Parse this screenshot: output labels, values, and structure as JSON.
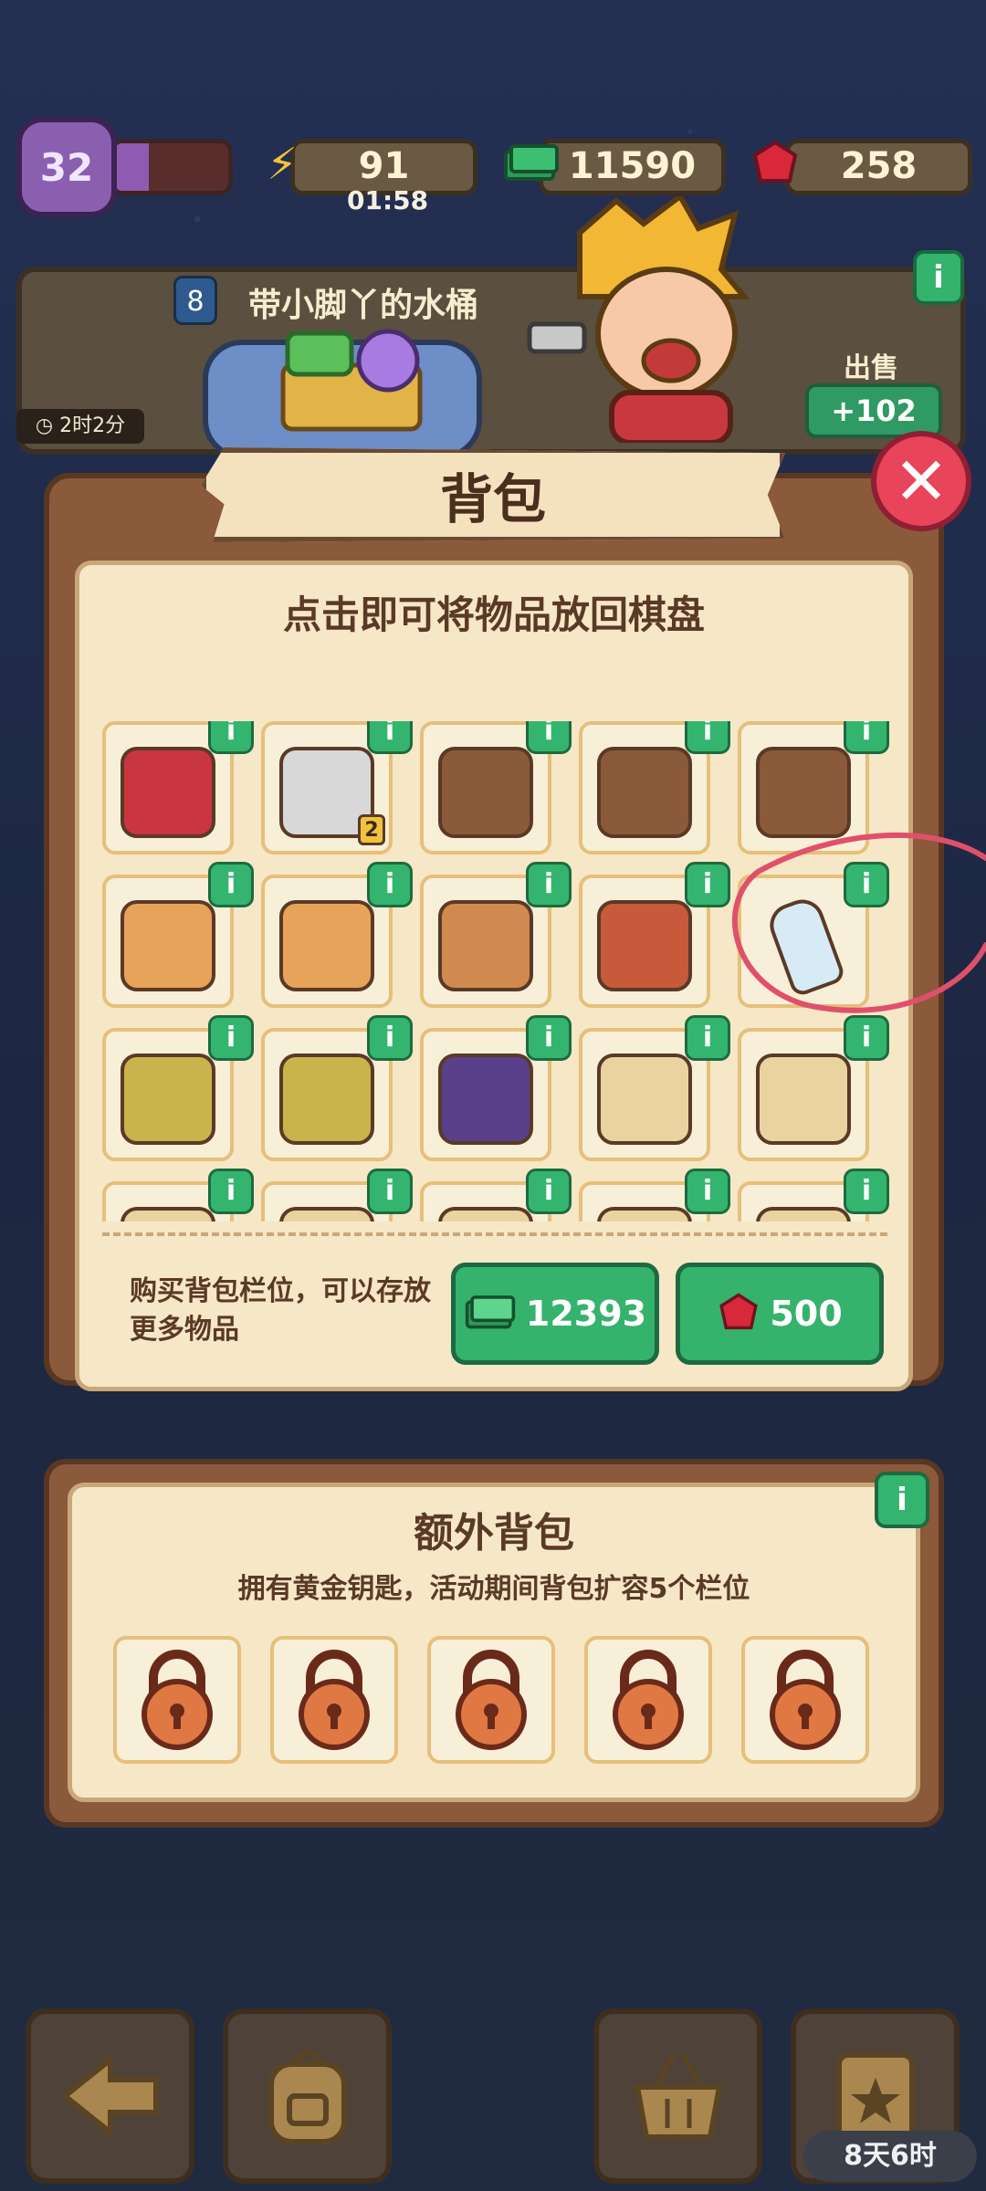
{
  "hud": {
    "level": "32",
    "level_progress": 0.3,
    "energy": "91",
    "energy_timer": "01:58",
    "cash": "11590",
    "gems": "258"
  },
  "task": {
    "level": "8",
    "title": "带小脚丫的水桶",
    "time_left": "2时2分",
    "sell_label": "出售",
    "sell_value": "+102"
  },
  "backpack": {
    "title": "背包",
    "subtitle": "点击即可将物品放回棋盘",
    "info_label": "i",
    "items": [
      {
        "name": "red-toolbox-icon",
        "color": "#c9363f"
      },
      {
        "name": "sewing-machine-icon",
        "color": "#d8d8d8",
        "badge": "2"
      },
      {
        "name": "folders-icon",
        "color": "#8b5a3b"
      },
      {
        "name": "folders-icon",
        "color": "#8b5a3b"
      },
      {
        "name": "folders-icon",
        "color": "#8b5a3b"
      },
      {
        "name": "envelope-icon",
        "color": "#e8a35a"
      },
      {
        "name": "envelope-stack-icon",
        "color": "#e8a35a"
      },
      {
        "name": "parcel-stack-icon",
        "color": "#d08a4f"
      },
      {
        "name": "dragon-book-icon",
        "color": "#c75a3a"
      },
      {
        "name": "message-bottle-icon",
        "color": "#cfe4f2"
      },
      {
        "name": "sprout-creature-icon",
        "color": "#c8b44a"
      },
      {
        "name": "sprout-creature-bow-icon",
        "color": "#c8b44a"
      },
      {
        "name": "purple-wheel-icon",
        "color": "#5a3f8a"
      },
      {
        "name": "clover-box-icon",
        "color": "#e9d3a0"
      },
      {
        "name": "clover-box-icon",
        "color": "#e9d3a0"
      },
      {
        "name": "partial-item-icon",
        "color": "#e9d3a0"
      },
      {
        "name": "partial-item-icon",
        "color": "#e9d3a0"
      },
      {
        "name": "partial-item-icon",
        "color": "#e9d3a0"
      },
      {
        "name": "partial-item-icon",
        "color": "#e9d3a0"
      },
      {
        "name": "partial-item-icon",
        "color": "#e9d3a0"
      }
    ],
    "buy_text": "购买背包栏位，可以存放更多物品",
    "buy_cash": "12393",
    "buy_gems": "500"
  },
  "extra": {
    "title": "额外背包",
    "desc": "拥有黄金钥匙，活动期间背包扩容5个栏位",
    "slots": 5
  },
  "nav": {
    "timer": "8天6时"
  },
  "colors": {
    "panel": "#8b5a3b",
    "panel_inner": "#f6e7c7",
    "accent_green": "#35b26c",
    "close_red": "#e8445a",
    "annotation": "#e0506a"
  }
}
